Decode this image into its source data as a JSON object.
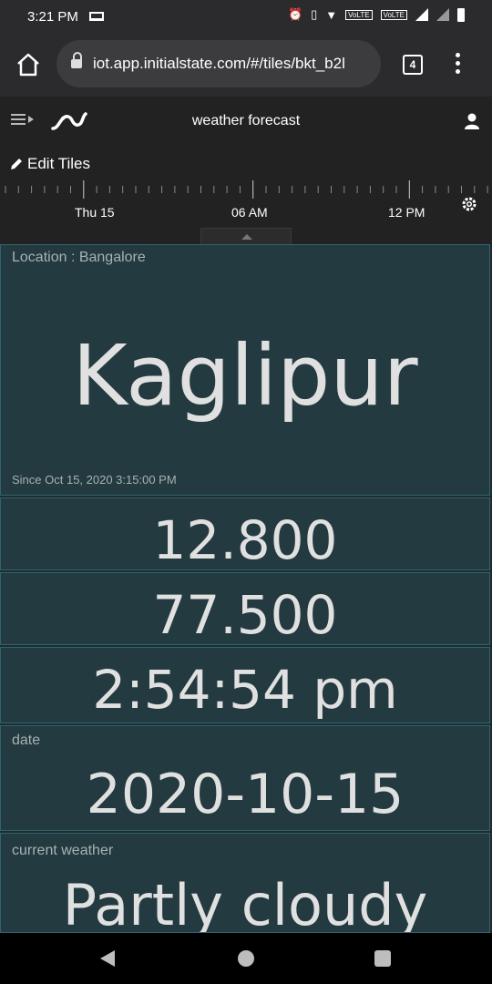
{
  "status": {
    "time": "3:21 PM"
  },
  "browser": {
    "url": "iot.app.initialstate.com/#/tiles/bkt_b2l",
    "tab_count": "4"
  },
  "app": {
    "title": "weather forecast",
    "edit_label": "Edit Tiles"
  },
  "timeline": {
    "labels": [
      "Thu 15",
      "06 AM",
      "12 PM"
    ]
  },
  "tiles": {
    "location": {
      "label": "Location : Bangalore",
      "value": "Kaglipur",
      "since": "Since Oct 15, 2020 3:15:00 PM"
    },
    "lat": {
      "value": "12.800"
    },
    "lon": {
      "value": "77.500"
    },
    "time": {
      "value": "2:54:54 pm"
    },
    "date": {
      "label": "date",
      "value": "2020-10-15"
    },
    "weather": {
      "label": "current weather",
      "value": "Partly cloudy"
    }
  },
  "colors": {
    "tile_bg": "#233a40",
    "tile_border": "#2e6470",
    "header_bg": "#222222"
  }
}
